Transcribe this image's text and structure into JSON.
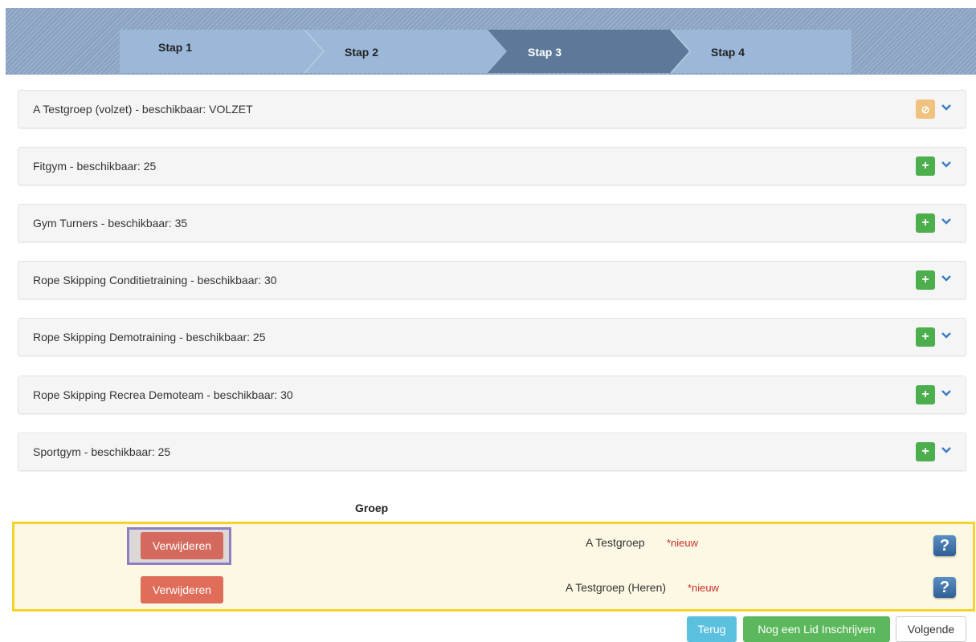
{
  "stepper": {
    "steps": [
      "Stap 1",
      "Stap 2",
      "Stap 3",
      "Stap 4"
    ],
    "active_step": 3
  },
  "groups": [
    {
      "title": "A Testgroep (volzet) - beschikbaar: VOLZET",
      "action_icon": "ban-icon",
      "status": "full"
    },
    {
      "title": "Fitgym - beschikbaar: 25",
      "action_icon": "plus-icon",
      "status": "available"
    },
    {
      "title": "Gym Turners - beschikbaar: 35",
      "action_icon": "plus-icon",
      "status": "available"
    },
    {
      "title": "Rope Skipping Conditietraining - beschikbaar: 30",
      "action_icon": "plus-icon",
      "status": "available"
    },
    {
      "title": "Rope Skipping Demotraining - beschikbaar: 25",
      "action_icon": "plus-icon",
      "status": "available"
    },
    {
      "title": "Rope Skipping Recrea Demoteam - beschikbaar: 30",
      "action_icon": "plus-icon",
      "status": "available"
    },
    {
      "title": "Sportgym - beschikbaar: 25",
      "action_icon": "plus-icon",
      "status": "available"
    }
  ],
  "summary": {
    "column_header": "Groep",
    "rows": [
      {
        "remove_label": "Verwijderen",
        "group": "A Testgroep",
        "tag": "*nieuw"
      },
      {
        "remove_label": "Verwijderen",
        "group": "A Testgroep (Heren)",
        "tag": "*nieuw"
      }
    ]
  },
  "footer": {
    "back_label": "Terug",
    "another_label": "Nog een Lid Inschrijven",
    "next_label": "Volgende"
  },
  "colors": {
    "active_step": "#5c7999",
    "add_button": "#4cae4c",
    "full_button": "#f0c27f",
    "remove_button": "#df6d5a",
    "highlight_border": "#f4d32a",
    "chevron": "#3b7dc4"
  }
}
